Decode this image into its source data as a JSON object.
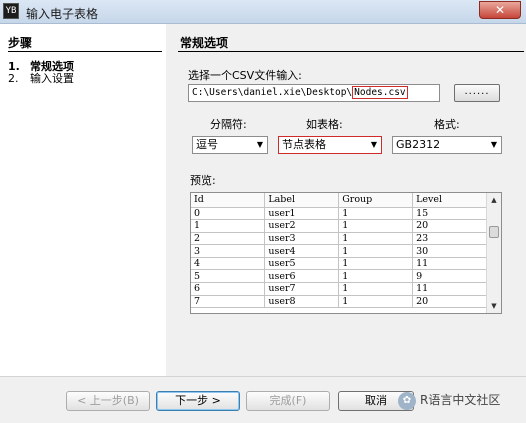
{
  "window": {
    "title": "输入电子表格",
    "app_icon": "YB",
    "close_symbol": "✕"
  },
  "left": {
    "title": "步骤",
    "steps": [
      {
        "num": "1.",
        "label": "常规选项"
      },
      {
        "num": "2.",
        "label": "输入设置"
      }
    ]
  },
  "right": {
    "title": "常规选项",
    "select_csv_label": "选择一个CSV文件输入:",
    "path_prefix": "C:\\Users\\daniel.xie\\Desktop\\",
    "path_file": "Nodes.csv",
    "browse_label": "......",
    "separator_label": "分隔符:",
    "table_label": "如表格:",
    "format_label": "格式:",
    "separator_value": "逗号",
    "table_value": "节点表格",
    "format_value": "GB2312",
    "preview_label": "预览:",
    "columns": [
      "Id",
      "Label",
      "Group",
      "Level"
    ],
    "rows": [
      [
        "0",
        "user1",
        "1",
        "15"
      ],
      [
        "1",
        "user2",
        "1",
        "20"
      ],
      [
        "2",
        "user3",
        "1",
        "23"
      ],
      [
        "3",
        "user4",
        "1",
        "30"
      ],
      [
        "4",
        "user5",
        "1",
        "11"
      ],
      [
        "5",
        "user6",
        "1",
        "9"
      ],
      [
        "6",
        "user7",
        "1",
        "11"
      ],
      [
        "7",
        "user8",
        "1",
        "20"
      ]
    ]
  },
  "footer": {
    "back": "< 上一步(B)",
    "next": "下一步 >",
    "finish": "完成(F)",
    "cancel": "取消",
    "watermark": "R语言中文社区"
  },
  "colors": {
    "highlight_border": "#d02b2b",
    "title_bar": "#c6d7ea"
  }
}
